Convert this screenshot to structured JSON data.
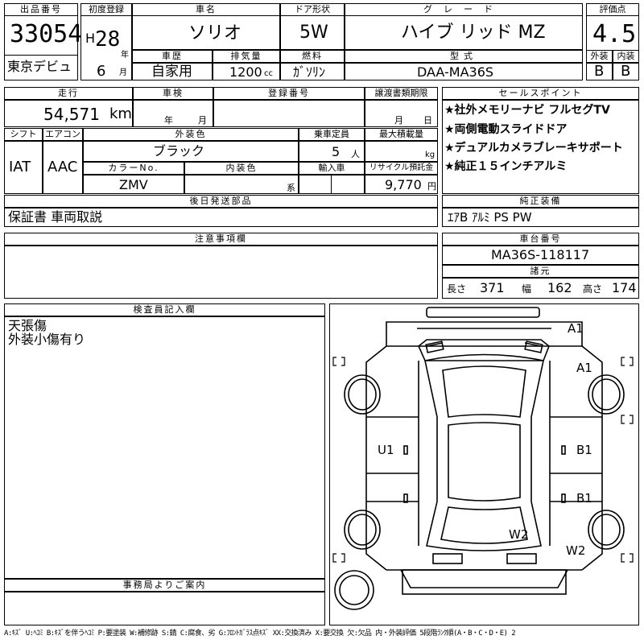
{
  "top": {
    "lot_label": "出品番号",
    "lot": "33054",
    "debut": "東京デビュ",
    "first_reg_label": "初度登録",
    "era": "H",
    "year": "28",
    "year_unit": "年",
    "month": "6",
    "month_unit": "月",
    "car_name_label": "車名",
    "car_name": "ソリオ",
    "door_label": "ドア形状",
    "door": "5W",
    "grade_label": "グレード",
    "grade": "ハイブ リッド MZ",
    "score_label": "評価点",
    "score": "4.5",
    "history_label": "車歴",
    "history": "自家用",
    "displacement_label": "排気量",
    "displacement": "1200",
    "cc": "cc",
    "fuel_label": "燃料",
    "fuel": "ｶﾞｿﾘﾝ",
    "model_label": "型式",
    "model": "DAA-MA36S",
    "ext_label": "外装",
    "ext": "B",
    "int_label": "内装",
    "int": "B"
  },
  "mid": {
    "mileage_label": "走行",
    "mileage": "54,571",
    "km": "km",
    "inspection_label": "車検",
    "insp_year": "年",
    "insp_month": "月",
    "regno_label": "登録番号",
    "transfer_label": "譲渡書類期限",
    "tr_month": "月",
    "tr_day": "日",
    "shift_label": "シフト",
    "shift": "IAT",
    "ac_label": "エアコン",
    "ac": "AAC",
    "color_label": "外装色",
    "color": "ブラック",
    "capacity_label": "乗車定員",
    "capacity": "5",
    "capacity_unit": "人",
    "load_label": "最大積載量",
    "load_unit": "kg",
    "color_no_label": "カラーNo.",
    "color_no": "ZMV",
    "interior_color_label": "内装色",
    "interior_suffix": "系",
    "import_label": "輸入車",
    "recycle_label": "リサイクル預託金",
    "recycle": "9,770",
    "yen": "円",
    "later_parts_label": "後日発送部品",
    "later_parts": "保証書 車両取説",
    "sales_label": "セールスポイント",
    "sales": [
      "★社外メモリーナビ フルセグTV",
      "★両側電動スライドドア",
      "★デュアルカメラブレーキサポート",
      "★純正１５インチアルミ"
    ],
    "equip_label": "純正装備",
    "equip": "ｴｱB ｱﾙﾐ PS PW"
  },
  "notes": {
    "caution_label": "注意事項欄",
    "caution": ""
  },
  "chassis": {
    "label": "車台番号",
    "value": "MA36S-118117",
    "dims_label": "諸元",
    "len_label": "長さ",
    "len": "371",
    "wid_label": "幅",
    "wid": "162",
    "hei_label": "高さ",
    "hei": "174"
  },
  "inspector": {
    "label": "検査員記入欄",
    "lines": [
      "天張傷",
      "外装小傷有り"
    ]
  },
  "office": {
    "label": "事務局よりご案内",
    "text": ""
  },
  "diagram": {
    "marks": [
      "A1",
      "A1",
      "U1",
      "B1",
      "B1",
      "W2",
      "W2"
    ]
  },
  "legend": "A:ｷｽﾞ U:ﾍｺﾐ B:ｷｽﾞを伴うﾍｺﾐ P:要塗装 W:補修跡 S:錆 C:腐食、劣 G:ﾌﾛﾝﾄｶﾞﾗｽ点ｷｽﾞ XX:交換済み X:要交換 欠:欠品 内・外装評価 5段階ﾗﾝｸ順(A・B・C・D・E) 2"
}
